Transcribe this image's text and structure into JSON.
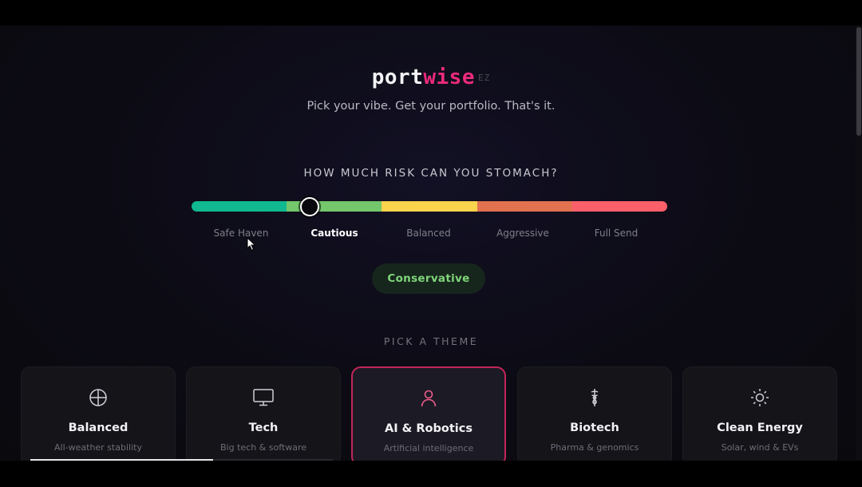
{
  "brand": {
    "part1": "port",
    "part2": "wise",
    "suffix": "EZ"
  },
  "tagline": "Pick your vibe. Get your portfolio. That's it.",
  "risk": {
    "heading": "HOW MUCH RISK CAN YOU STOMACH?",
    "levels": [
      "Safe Haven",
      "Cautious",
      "Balanced",
      "Aggressive",
      "Full Send"
    ],
    "selected_index": 1,
    "segment_colors": [
      "#10b98f",
      "#74c76a",
      "#fcd34d",
      "#e2714f",
      "#fb5f6a"
    ],
    "profile": "Conservative"
  },
  "theme": {
    "heading": "PICK A THEME",
    "cards": [
      {
        "title": "Balanced",
        "subtitle": "All-weather stability",
        "icon": "globe-icon"
      },
      {
        "title": "Tech",
        "subtitle": "Big tech & software",
        "icon": "monitor-icon"
      },
      {
        "title": "AI & Robotics",
        "subtitle": "Artificial intelligence",
        "icon": "person-icon"
      },
      {
        "title": "Biotech",
        "subtitle": "Pharma & genomics",
        "icon": "caduceus-icon"
      },
      {
        "title": "Clean Energy",
        "subtitle": "Solar, wind & EVs",
        "icon": "sun-icon"
      }
    ],
    "selected_index": 2
  },
  "colors": {
    "accent": "#ec2a7c",
    "selected_border": "#c2265a",
    "profile_text": "#7fd67a"
  }
}
